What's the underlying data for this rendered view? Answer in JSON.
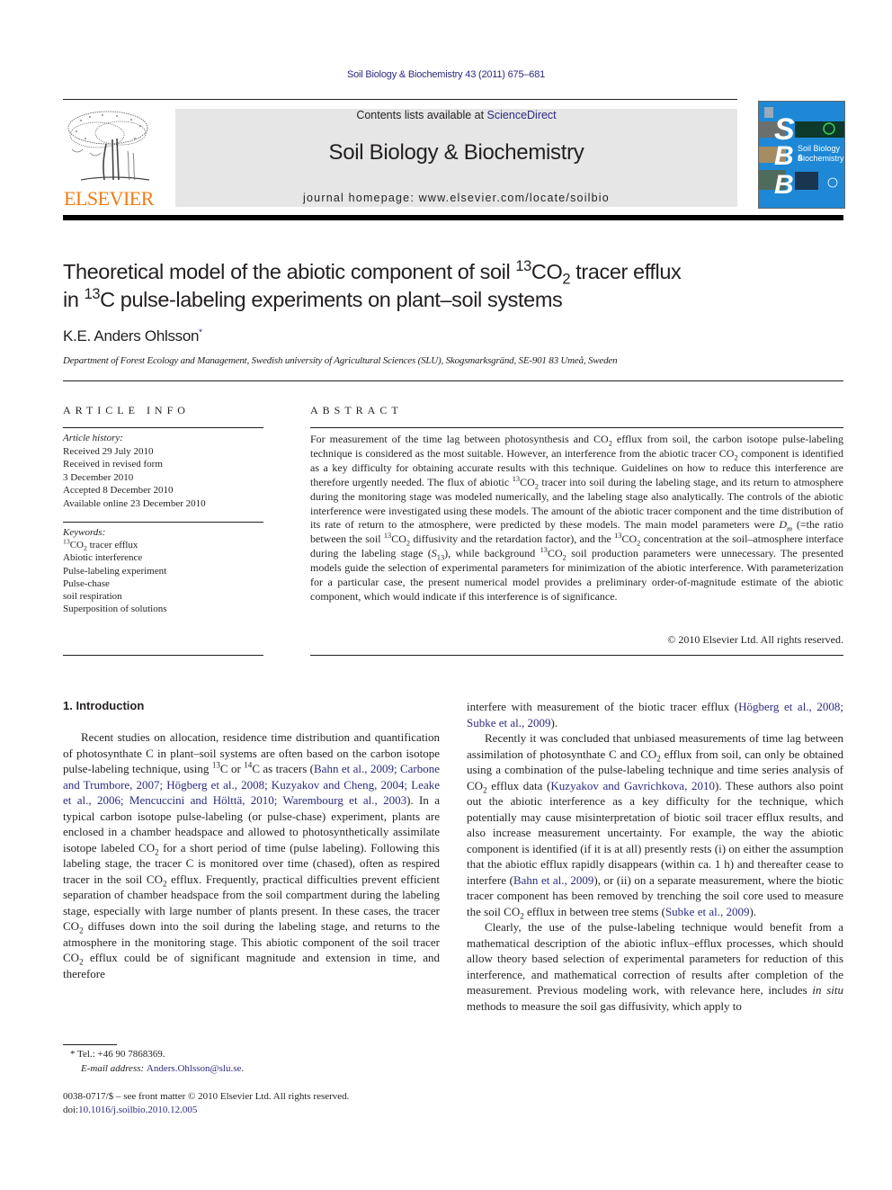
{
  "header": {
    "citation": "Soil Biology & Biochemistry 43 (2011) 675–681",
    "publisher": "ELSEVIER",
    "contents_prefix": "Contents lists available at ",
    "contents_link": "ScienceDirect",
    "journal_name": "Soil Biology & Biochemistry",
    "homepage": "journal homepage: www.elsevier.com/locate/soilbio",
    "cover": {
      "letters": [
        "S",
        "B",
        "B"
      ],
      "title_line1": "Soil Biology &",
      "title_line2": "Biochemistry",
      "background_color": "#1e88d6"
    },
    "publisher_color": "#f07b12"
  },
  "article": {
    "title_part1": "Theoretical model of the abiotic component of soil ",
    "title_sup1": "13",
    "title_part2": "CO",
    "title_sub1": "2",
    "title_part3": " tracer efflux",
    "title_line2_part1": "in ",
    "title_sup2": "13",
    "title_line2_part2": "C pulse-labeling experiments on plant–soil systems",
    "author": "K.E. Anders Ohlsson",
    "author_mark": "*",
    "affiliation": "Department of Forest Ecology and Management, Swedish university of Agricultural Sciences (SLU), Skogsmarksgränd, SE-901 83 Umeå, Sweden"
  },
  "article_info": {
    "heading": "ARTICLE INFO",
    "history_label": "Article history:",
    "history": [
      "Received 29 July 2010",
      "Received in revised form",
      "3 December 2010",
      "Accepted 8 December 2010",
      "Available online 23 December 2010"
    ],
    "keywords_label": "Keywords:",
    "keyword_first_sup": "13",
    "keyword_first_main": "CO",
    "keyword_first_sub": "2",
    "keyword_first_rest": " tracer efflux",
    "keywords": [
      "Abiotic interference",
      "Pulse-labeling experiment",
      "Pulse-chase",
      "soil respiration",
      "Superposition of solutions"
    ]
  },
  "abstract": {
    "heading": "ABSTRACT",
    "p1": "For measurement of the time lag between photosynthesis and CO",
    "p2": " efflux from soil, the carbon isotope pulse-labeling technique is considered as the most suitable. However, an interference from the abiotic tracer CO",
    "p3": " component is identified as a key difficulty for obtaining accurate results with this technique. Guidelines on how to reduce this interference are therefore urgently needed. The flux of abiotic ",
    "p4": "CO",
    "p5": " tracer into soil during the labeling stage, and its return to atmosphere during the monitoring stage was modeled numerically, and the labeling stage also analytically. The controls of the abiotic interference were investigated using these models. The amount of the abiotic tracer component and the time distribution of its rate of return to the atmosphere, were predicted by these models. The main model parameters were ",
    "dm": "D",
    "dm_sub": "m",
    "p6": " (=the ratio between the soil ",
    "p7": "CO",
    "p8": " diffusivity and the retardation factor), and the ",
    "p9": "CO",
    "p10": " concentration at the soil–atmosphere interface during the labeling stage (",
    "s13": "S",
    "s13_sub": "13",
    "p11": "), while background ",
    "p12": "CO",
    "p13": " soil production parameters were unnecessary. The presented models guide the selection of experimental parameters for minimization of the abiotic interference. With parameterization for a particular case, the present numerical model provides a preliminary order-of-magnitude estimate of the abiotic component, which would indicate if this interference is of significance.",
    "sup13": "13",
    "sub2": "2",
    "copyright": "© 2010 Elsevier Ltd. All rights reserved."
  },
  "introduction": {
    "heading": "1.  Introduction",
    "l1": "Recent studies on allocation, residence time distribution and quantification of photosynthate C in plant–soil systems are often based on the carbon isotope pulse-labeling technique, using ",
    "l1b": "C or ",
    "l1c": "C as tracers (",
    "cite1": "Bahn et al., 2009; Carbone and Trumbore, 2007; Högberg et al., 2008; Kuzyakov and Cheng, 2004; Leake et al., 2006; Mencuccini and Hölttä, 2010; Warembourg et al., 2003",
    "l2": "). In a typical carbon isotope pulse-labeling (or pulse-chase) experiment, plants are enclosed in a chamber headspace and allowed to photosynthetically assimilate isotope labeled CO",
    "l3": " for a short period of time (pulse labeling). Following this labeling stage, the tracer C is monitored over time (chased), often as respired tracer in the soil CO",
    "l4": " efflux. Frequently, practical difficulties prevent efficient separation of chamber headspace from the soil compartment during the labeling stage, especially with large number of plants present. In these cases, the tracer CO",
    "l5": " diffuses down into the soil during the labeling stage, and returns to the atmosphere in the monitoring stage. This abiotic component of the soil tracer CO",
    "l6": " efflux could be of significant magnitude and extension in time, and therefore",
    "sup13": "13",
    "sup14": "14",
    "sub2": "2",
    "r1": "interfere with measurement of the biotic tracer efflux (",
    "cite2": "Högberg et al., 2008; Subke et al., 2009",
    "r1b": ").",
    "r2": "Recently it was concluded that unbiased measurements of time lag between assimilation of photosynthate C and CO",
    "r3": " efflux from soil, can only be obtained using a combination of the pulse-labeling technique and time series analysis of CO",
    "r4": " efflux data (",
    "cite3": "Kuzyakov and Gavrichkova, 2010",
    "r5": "). These authors also point out the abiotic interference as a key difficulty for the technique, which potentially may cause misinterpretation of biotic soil tracer efflux results, and also increase measurement uncertainty. For example, the way the abiotic component is identified (if it is at all) presently rests (i) on either the assumption that the abiotic efflux rapidly disappears (within ca. 1 h) and thereafter cease to interfere (",
    "cite4": "Bahn et al., 2009",
    "r6": "), or (ii) on a separate measurement, where the biotic tracer component has been removed by trenching the soil core used to measure the soil CO",
    "r7": " efflux in between tree stems (",
    "cite5": "Subke et al., 2009",
    "r8": ").",
    "r9": "Clearly, the use of the pulse-labeling technique would benefit from a mathematical description of the abiotic influx–efflux processes, which should allow theory based selection of experimental parameters for reduction of this interference, and mathematical correction of results after completion of the measurement. Previous modeling work, with relevance here, includes ",
    "r9_ital": "in situ",
    "r10": " methods to measure the soil gas diffusivity, which apply to"
  },
  "footnote": {
    "mark": "*",
    "tel": " Tel.: +46 90 7868369.",
    "email_label": "E-mail address: ",
    "email": "Anders.Ohlsson@slu.se",
    "email_end": "."
  },
  "front_matter": {
    "issn": "0038-0717/$ – see front matter © 2010 Elsevier Ltd. All rights reserved.",
    "doi_label": "doi:",
    "doi": "10.1016/j.soilbio.2010.12.005"
  }
}
